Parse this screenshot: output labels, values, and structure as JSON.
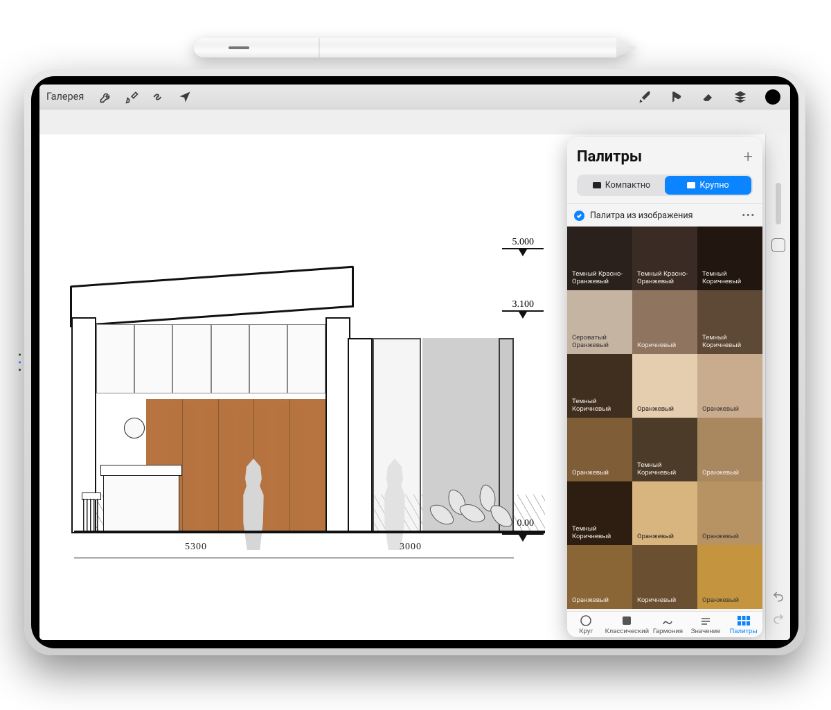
{
  "toolbar": {
    "gallery": "Галерея"
  },
  "sketch": {
    "dim_5300": "5300",
    "dim_3000": "3000",
    "lvl_000": "0.00",
    "lvl_3100": "3.100",
    "lvl_5000": "5.000"
  },
  "panel": {
    "title": "Палитры",
    "compact": "Компактно",
    "large": "Крупно",
    "palette_name": "Палитра из изображения",
    "tabs": {
      "circle": "Круг",
      "classic": "Классический",
      "harmony": "Гармония",
      "value": "Значение",
      "palettes": "Палитры"
    },
    "swatches": [
      {
        "label": "Темный Красно-Оранжевый",
        "color": "#2a201c"
      },
      {
        "label": "Темный Красно-Оранжевый",
        "color": "#3a2c25"
      },
      {
        "label": "Темный Коричневый",
        "color": "#211610"
      },
      {
        "label": "Сероватый Оранжевый",
        "color": "#c6b4a2"
      },
      {
        "label": "Коричневый",
        "color": "#8f7460"
      },
      {
        "label": "Темный Коричневый",
        "color": "#5e4936"
      },
      {
        "label": "Темный Коричневый",
        "color": "#402e1e"
      },
      {
        "label": "Оранжевый",
        "color": "#e5cdb0"
      },
      {
        "label": "Оранжевый",
        "color": "#c9ac8d"
      },
      {
        "label": "Оранжевый",
        "color": "#7f5d36"
      },
      {
        "label": "Темный Коричневый",
        "color": "#4d3b29"
      },
      {
        "label": "Оранжевый",
        "color": "#aa885f"
      },
      {
        "label": "Темный Коричневый",
        "color": "#2d1e11"
      },
      {
        "label": "Оранжевый",
        "color": "#d8b57f"
      },
      {
        "label": "Оранжевый",
        "color": "#b79363"
      },
      {
        "label": "Оранжевый",
        "color": "#8a6636"
      },
      {
        "label": "Коричневый",
        "color": "#6a4f31"
      },
      {
        "label": "Оранжевый",
        "color": "#c4953e"
      }
    ]
  }
}
